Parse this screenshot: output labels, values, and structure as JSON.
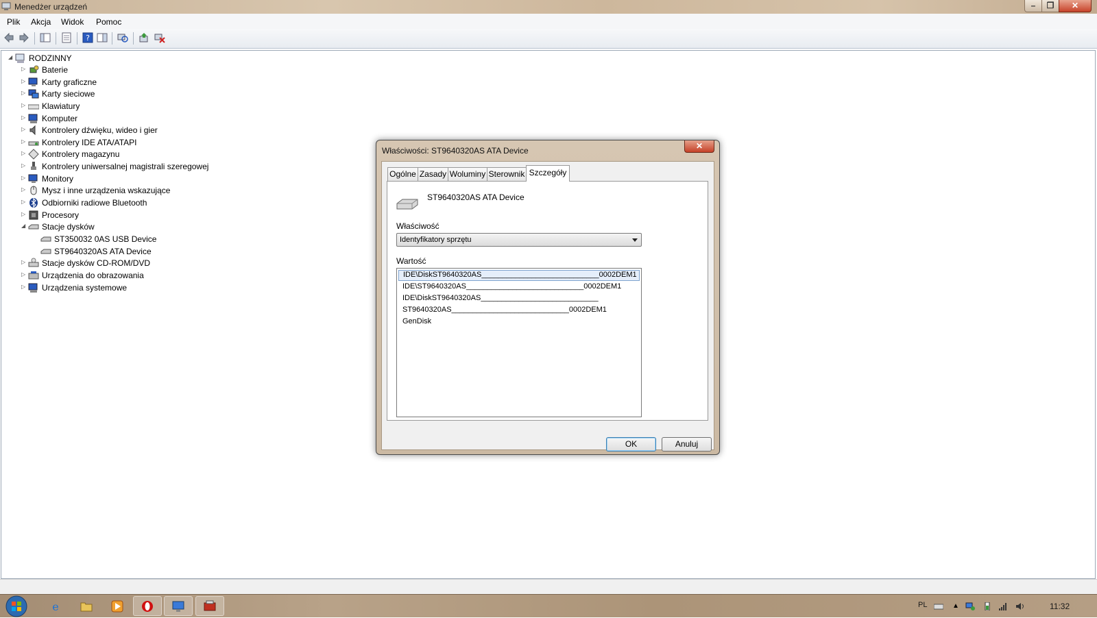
{
  "window": {
    "title": "Menedżer urządzeń",
    "menu": [
      "Plik",
      "Akcja",
      "Widok",
      "Pomoc"
    ],
    "toolbar_icons": [
      "back-arrow-icon",
      "forward-arrow-icon",
      "show-hide-tree-icon",
      "properties-icon",
      "help-icon",
      "action-pane-icon",
      "scan-hardware-icon",
      "update-driver-icon",
      "uninstall-icon"
    ]
  },
  "tree": {
    "root": "RODZINNY",
    "items": [
      {
        "label": "Baterie",
        "icon": "battery-icon"
      },
      {
        "label": "Karty graficzne",
        "icon": "display-adapter-icon"
      },
      {
        "label": "Karty sieciowe",
        "icon": "network-adapter-icon"
      },
      {
        "label": "Klawiatury",
        "icon": "keyboard-icon"
      },
      {
        "label": "Komputer",
        "icon": "computer-icon"
      },
      {
        "label": "Kontrolery dźwięku, wideo i gier",
        "icon": "speaker-icon"
      },
      {
        "label": "Kontrolery IDE ATA/ATAPI",
        "icon": "ide-controller-icon"
      },
      {
        "label": "Kontrolery magazynu",
        "icon": "storage-controller-icon"
      },
      {
        "label": "Kontrolery uniwersalnej magistrali szeregowej",
        "icon": "usb-icon"
      },
      {
        "label": "Monitory",
        "icon": "monitor-icon"
      },
      {
        "label": "Mysz i inne urządzenia wskazujące",
        "icon": "mouse-icon"
      },
      {
        "label": "Odbiorniki radiowe Bluetooth",
        "icon": "bluetooth-icon"
      },
      {
        "label": "Procesory",
        "icon": "processor-icon"
      },
      {
        "label": "Stacje dysków",
        "icon": "disk-drive-icon"
      },
      {
        "label": "ST350032 0AS USB Device",
        "icon": "disk-drive-icon"
      },
      {
        "label": "ST9640320AS ATA Device",
        "icon": "disk-drive-icon"
      },
      {
        "label": "Stacje dysków CD-ROM/DVD",
        "icon": "cdrom-icon"
      },
      {
        "label": "Urządzenia do obrazowania",
        "icon": "imaging-device-icon"
      },
      {
        "label": "Urządzenia systemowe",
        "icon": "system-device-icon"
      }
    ]
  },
  "dialog": {
    "title": "Właściwości: ST9640320AS ATA Device",
    "tabs": [
      "Ogólne",
      "Zasady",
      "Woluminy",
      "Sterownik",
      "Szczegóły"
    ],
    "selected_tab": "Szczegóły",
    "device_name": "ST9640320AS ATA Device",
    "property_label": "Właściwość",
    "property_value": "Identyfikatory sprzętu",
    "value_label": "Wartość",
    "values": [
      "IDE\\DiskST9640320AS____________________________0002DEM1",
      "IDE\\ST9640320AS____________________________0002DEM1",
      "IDE\\DiskST9640320AS____________________________",
      "ST9640320AS____________________________0002DEM1",
      "GenDisk"
    ],
    "ok_label": "OK",
    "cancel_label": "Anuluj"
  },
  "taskbar": {
    "language": "PL",
    "clock": "11:32",
    "apps": [
      "internet-explorer-icon",
      "explorer-folder-icon",
      "media-player-icon",
      "opera-icon",
      "remote-desktop-icon",
      "device-manager-icon"
    ]
  },
  "colors": {
    "accent": "#3c7fb1",
    "close_button": "#c54128",
    "selection": "#e5eefa"
  }
}
